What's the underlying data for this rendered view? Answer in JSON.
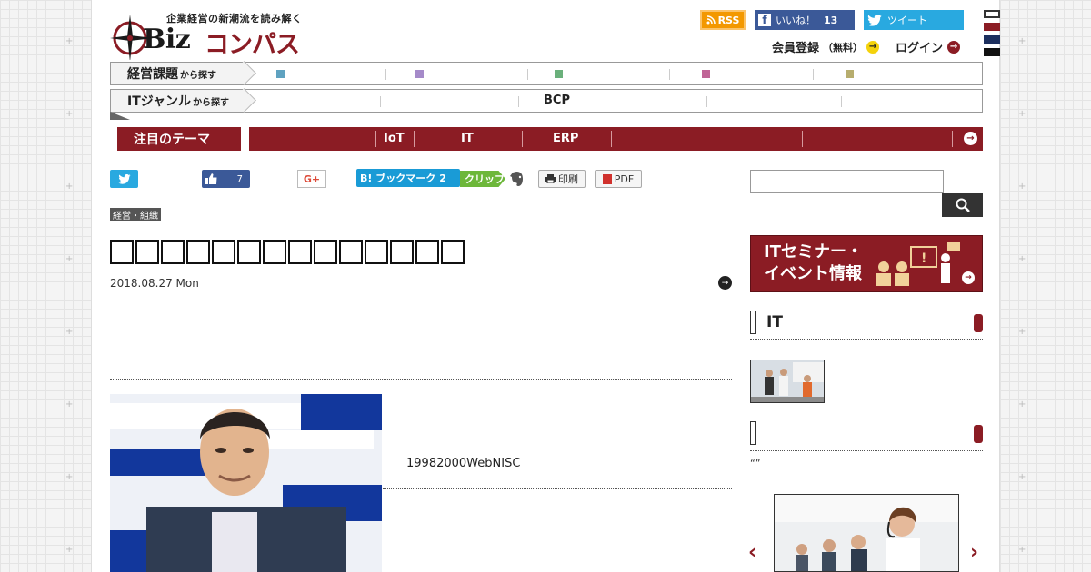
{
  "header": {
    "tagline": "企業経営の新潮流を読み解く",
    "logo_latin": "Biz",
    "logo_kana": "コンパス",
    "rss_label": "RSS",
    "fb_label": "いいね！",
    "fb_count": "13",
    "tweet_label": "ツイート",
    "register_label": "会員登録",
    "register_small": "（無料）",
    "login_label": "ログイン"
  },
  "nav": {
    "row1_label": "経営課題",
    "row1_suffix": "から探す",
    "row2_label": "ITジャンル",
    "row2_suffix": "から探す",
    "row2_item": "BCP"
  },
  "theme_bar": {
    "label": "注目のテーマ",
    "items": [
      "IoT",
      "IT",
      "ERP"
    ]
  },
  "share": {
    "like_count": "7",
    "gplus_label": "G+",
    "hatena_label": "B! ブックマーク",
    "hatena_count": "2",
    "clip_label": "クリップ",
    "print_label": "印刷",
    "pdf_label": "PDF"
  },
  "article": {
    "category": "経営・組織",
    "title": "",
    "date": "2018.08.27 Mon",
    "lead": "19982000WebNISC"
  },
  "sidebar": {
    "banner_line1": "ITセミナー・",
    "banner_line2": "イベント情報",
    "section1_title": "IT",
    "quote": "“”"
  },
  "colors": {
    "brand_red": "#8b1c24",
    "rss_orange": "#f39800",
    "facebook_blue": "#3b5998",
    "twitter_blue": "#29a9e0",
    "hatena_blue": "#1a9bd6",
    "clip_green": "#6db73a"
  },
  "icons": {
    "rss": "rss-icon",
    "facebook": "facebook-icon",
    "twitter": "twitter-bird-icon",
    "search": "search-icon",
    "evernote": "evernote-elephant-icon",
    "print": "printer-icon",
    "pdf": "pdf-icon",
    "arrow": "arrow-right-circle-icon"
  }
}
